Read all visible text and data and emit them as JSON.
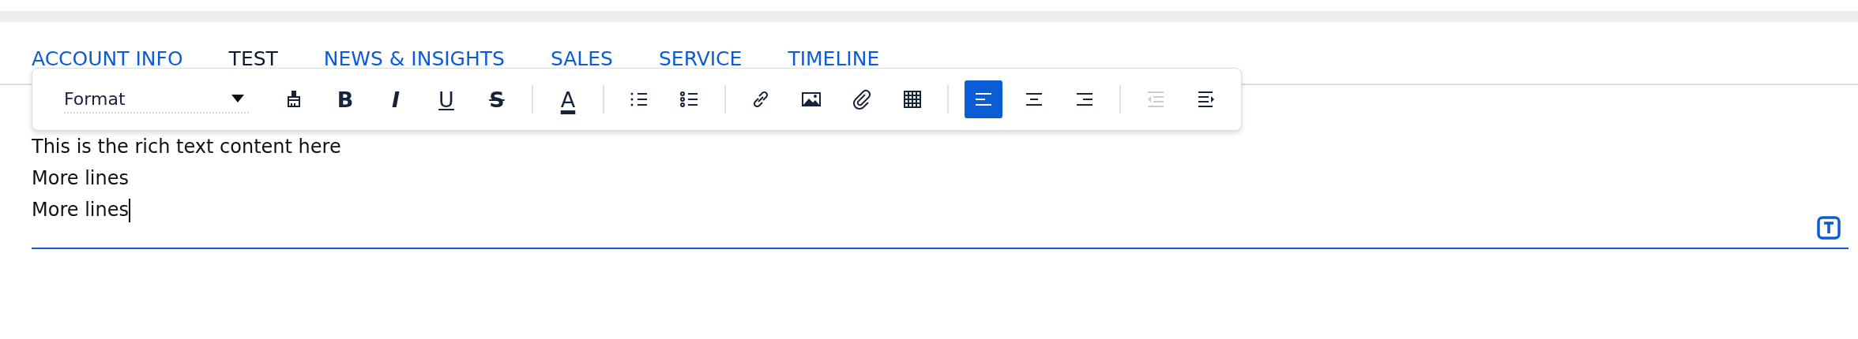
{
  "tabs": [
    {
      "label": "ACCOUNT INFO",
      "selected": false
    },
    {
      "label": "TEST",
      "selected": true
    },
    {
      "label": "NEWS & INSIGHTS",
      "selected": false
    },
    {
      "label": "SALES",
      "selected": false
    },
    {
      "label": "SERVICE",
      "selected": false
    },
    {
      "label": "TIMELINE",
      "selected": false
    }
  ],
  "toolbar": {
    "format": {
      "value": "Format"
    },
    "groups": [
      [
        {
          "kind": "painter",
          "selected": false,
          "disabled": false
        },
        {
          "kind": "bold",
          "label": "B",
          "selected": false,
          "disabled": false
        },
        {
          "kind": "italic",
          "label": "I",
          "selected": false,
          "disabled": false
        },
        {
          "kind": "underline",
          "label": "U",
          "selected": false,
          "disabled": false
        },
        {
          "kind": "strike",
          "label": "S",
          "selected": false,
          "disabled": false
        }
      ],
      [
        {
          "kind": "color",
          "label": "A",
          "selected": false,
          "disabled": false
        }
      ],
      [
        {
          "kind": "numbered",
          "selected": false,
          "disabled": false
        },
        {
          "kind": "bulleted",
          "selected": false,
          "disabled": false
        }
      ],
      [
        {
          "kind": "link",
          "selected": false,
          "disabled": false
        },
        {
          "kind": "image",
          "selected": false,
          "disabled": false
        },
        {
          "kind": "attach",
          "selected": false,
          "disabled": false
        },
        {
          "kind": "table",
          "selected": false,
          "disabled": false
        }
      ],
      [
        {
          "kind": "left",
          "selected": true,
          "disabled": false
        },
        {
          "kind": "center",
          "selected": false,
          "disabled": false
        },
        {
          "kind": "right",
          "selected": false,
          "disabled": false
        }
      ],
      [
        {
          "kind": "outdent",
          "selected": false,
          "disabled": true
        },
        {
          "kind": "indent",
          "selected": false,
          "disabled": false
        }
      ]
    ]
  },
  "editor": {
    "lines": [
      "This is the rich text content here",
      "More lines",
      "More lines"
    ]
  }
}
